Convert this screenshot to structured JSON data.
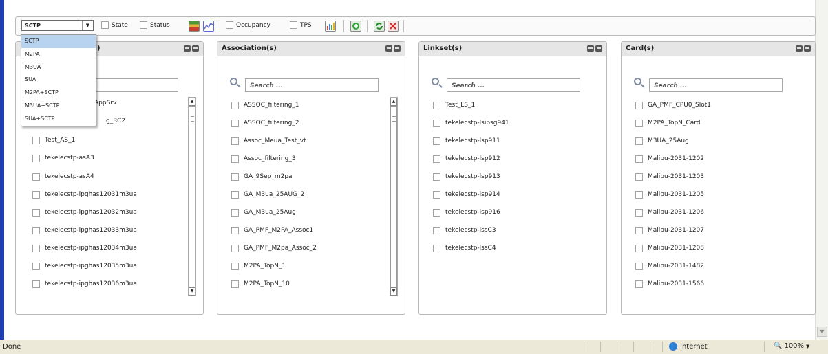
{
  "toolbar": {
    "protocol_value": "SCTP",
    "state_label": "State",
    "status_label": "Status",
    "occupancy_label": "Occupancy",
    "tps_label": "TPS"
  },
  "dropdown": {
    "options": [
      "SCTP",
      "M2PA",
      "M3UA",
      "SUA",
      "M2PA+SCTP",
      "M3UA+SCTP",
      "SUA+SCTP"
    ],
    "selected": "SCTP"
  },
  "panels": [
    {
      "title": ")",
      "search_placeholder": "",
      "items": [
        "AppSrv",
        "g_RC2",
        "Test_AS_1",
        "tekelecstp-asA3",
        "tekelecstp-asA4",
        "tekelecstp-ipghas12031m3ua",
        "tekelecstp-ipghas12032m3ua",
        "tekelecstp-ipghas12033m3ua",
        "tekelecstp-ipghas12034m3ua",
        "tekelecstp-ipghas12035m3ua",
        "tekelecstp-ipghas12036m3ua"
      ]
    },
    {
      "title": "Association(s)",
      "search_placeholder": "Search ...",
      "items": [
        "ASSOC_filtering_1",
        "ASSOC_filtering_2",
        "Assoc_Meua_Test_vt",
        "Assoc_filtering_3",
        "GA_9Sep_m2pa",
        "GA_M3ua_25AUG_2",
        "GA_M3ua_25Aug",
        "GA_PMF_M2PA_Assoc1",
        "GA_PMF_M2pa_Assoc_2",
        "M2PA_TopN_1",
        "M2PA_TopN_10"
      ]
    },
    {
      "title": "Linkset(s)",
      "search_placeholder": "Search ...",
      "items": [
        "Test_LS_1",
        "tekelecstp-lsipsg941",
        "tekelecstp-lsp911",
        "tekelecstp-lsp912",
        "tekelecstp-lsp913",
        "tekelecstp-lsp914",
        "tekelecstp-lsp916",
        "tekelecstp-lssC3",
        "tekelecstp-lssC4"
      ]
    },
    {
      "title": "Card(s)",
      "search_placeholder": "Search ...",
      "items": [
        "GA_PMF_CPU0_Slot1",
        "M2PA_TopN_Card",
        "M3UA_25Aug",
        "Malibu-2031-1202",
        "Malibu-2031-1203",
        "Malibu-2031-1205",
        "Malibu-2031-1206",
        "Malibu-2031-1207",
        "Malibu-2031-1208",
        "Malibu-2031-1482",
        "Malibu-2031-1566"
      ]
    }
  ],
  "statusbar": {
    "status": "Done",
    "zone": "Internet",
    "zoom": "100%"
  }
}
